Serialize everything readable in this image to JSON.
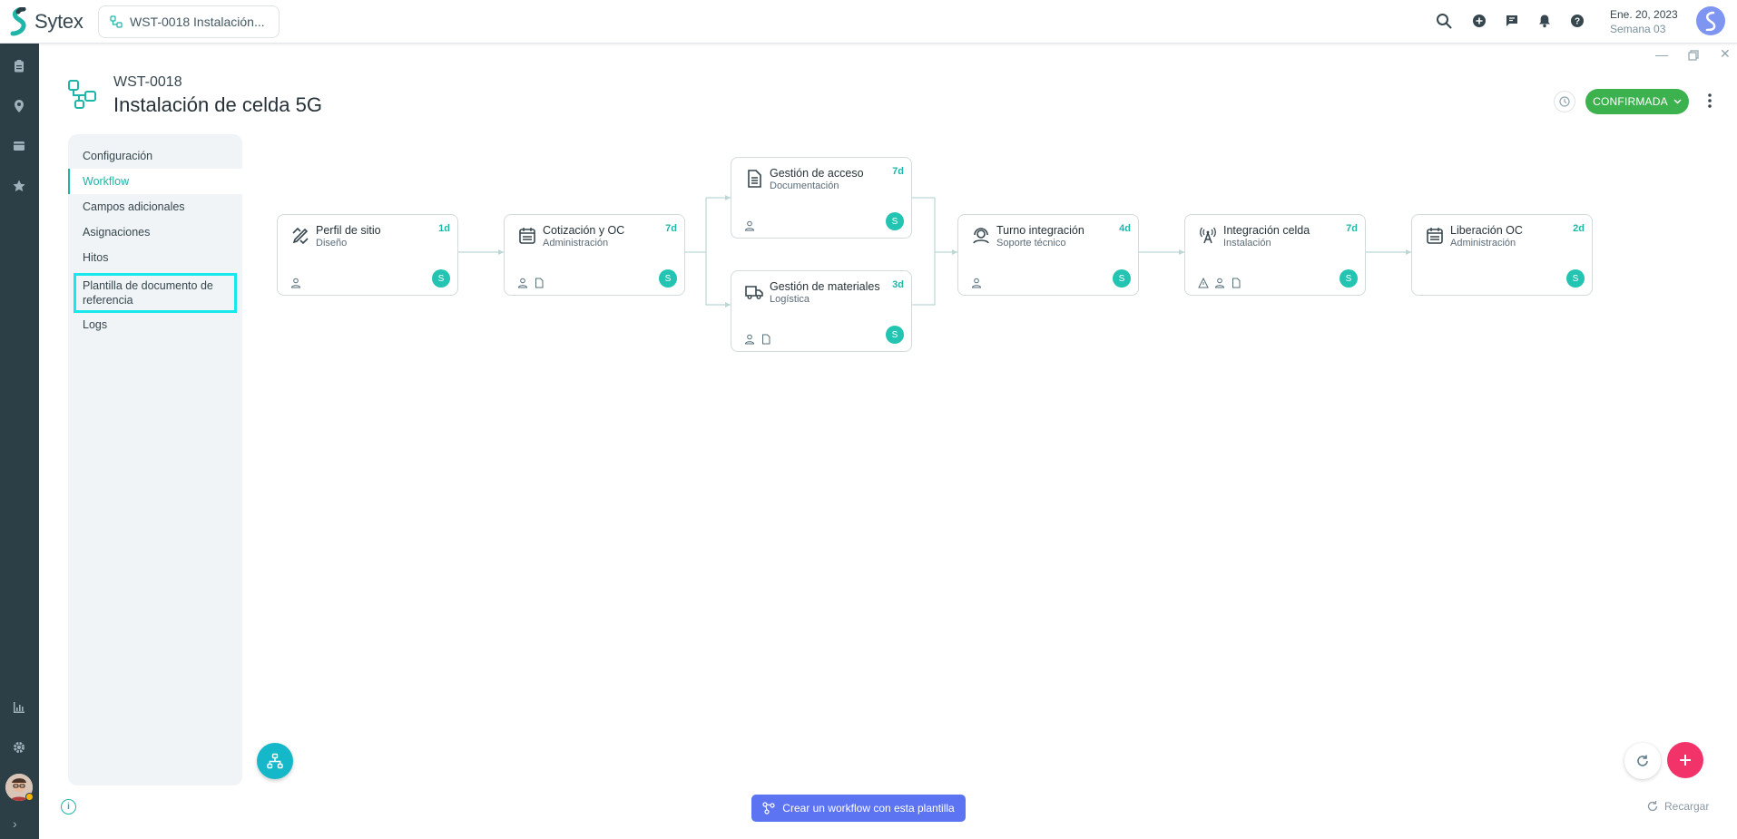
{
  "app": {
    "name": "Sytex",
    "tab_label": "WST-0018 Instalación..."
  },
  "topbar": {
    "date": "Ene. 20, 2023",
    "week": "Semana 03"
  },
  "page": {
    "code": "WST-0018",
    "title": "Instalación de celda 5G",
    "status": "CONFIRMADA"
  },
  "sidebar": {
    "items": [
      {
        "label": "Configuración"
      },
      {
        "label": "Workflow"
      },
      {
        "label": "Campos adicionales"
      },
      {
        "label": "Asignaciones"
      },
      {
        "label": "Hitos"
      },
      {
        "label": "Plantilla de documento de referencia"
      },
      {
        "label": "Logs"
      }
    ],
    "active": "Workflow",
    "highlighted": "Plantilla de documento de referencia"
  },
  "workflow": {
    "nodes": [
      {
        "name": "Perfil de sitio",
        "area": "Diseño",
        "duration": "1d",
        "icon": "pencil-ruler-icon",
        "assignee": "S",
        "footer_icons": [
          "user-icon"
        ]
      },
      {
        "name": "Cotización y OC",
        "area": "Administración",
        "duration": "7d",
        "icon": "calendar-list-icon",
        "assignee": "S",
        "footer_icons": [
          "user-icon",
          "document-icon"
        ]
      },
      {
        "name": "Gestión de acceso",
        "area": "Documentación",
        "duration": "7d",
        "icon": "document-icon",
        "assignee": "S",
        "footer_icons": [
          "user-icon"
        ]
      },
      {
        "name": "Gestión de materiales",
        "area": "Logística",
        "duration": "3d",
        "icon": "truck-icon",
        "assignee": "S",
        "footer_icons": [
          "user-icon",
          "document-icon"
        ]
      },
      {
        "name": "Turno integración",
        "area": "Soporte técnico",
        "duration": "4d",
        "icon": "support-agent-icon",
        "assignee": "S",
        "footer_icons": [
          "user-icon"
        ]
      },
      {
        "name": "Integración celda",
        "area": "Instalación",
        "duration": "7d",
        "icon": "antenna-icon",
        "assignee": "S",
        "footer_icons": [
          "warning-icon",
          "user-icon",
          "document-icon"
        ]
      },
      {
        "name": "Liberación OC",
        "area": "Administración",
        "duration": "2d",
        "icon": "calendar-list-icon",
        "assignee": "S",
        "footer_icons": []
      }
    ]
  },
  "footer": {
    "create_label": "Crear un workflow con esta plantilla",
    "reload_label": "Recargar"
  },
  "colors": {
    "accent": "#1fb5a8",
    "status": "#3bb24e",
    "create": "#5c73f2",
    "add": "#f2336a",
    "rail": "#2c3e46",
    "highlight": "#16e8ee"
  }
}
